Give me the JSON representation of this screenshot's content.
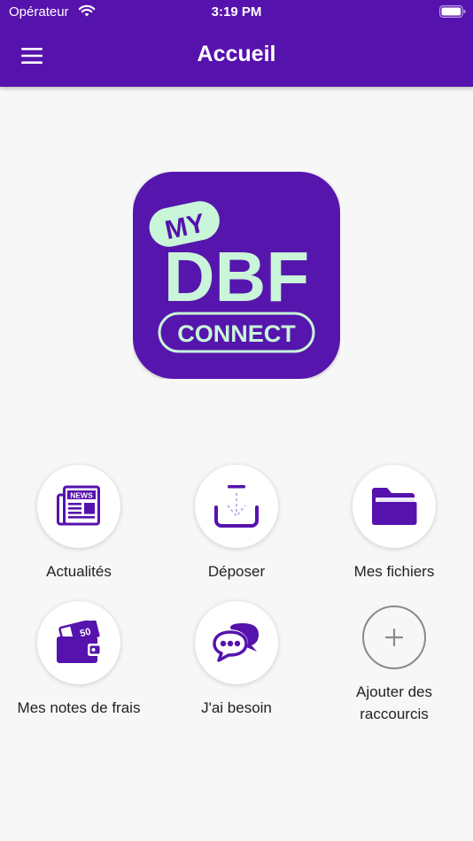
{
  "status_bar": {
    "carrier": "Opérateur",
    "time": "3:19 PM"
  },
  "header": {
    "title": "Accueil"
  },
  "logo": {
    "badge": "MY",
    "name": "DBF",
    "tagline": "CONNECT"
  },
  "shortcuts": [
    {
      "label": "Actualités",
      "icon": "news-icon"
    },
    {
      "label": "Déposer",
      "icon": "download-tray-icon"
    },
    {
      "label": "Mes fichiers",
      "icon": "folder-icon"
    },
    {
      "label": "Mes notes de frais",
      "icon": "wallet-icon"
    },
    {
      "label": "J'ai besoin",
      "icon": "chat-bubbles-icon"
    }
  ],
  "add_shortcut": {
    "label_line1": "Ajouter des",
    "label_line2": "raccourcis",
    "icon": "plus-icon"
  },
  "colors": {
    "primary": "#5612ad",
    "accent": "#c9f5d9",
    "background": "#f7f7f7"
  }
}
